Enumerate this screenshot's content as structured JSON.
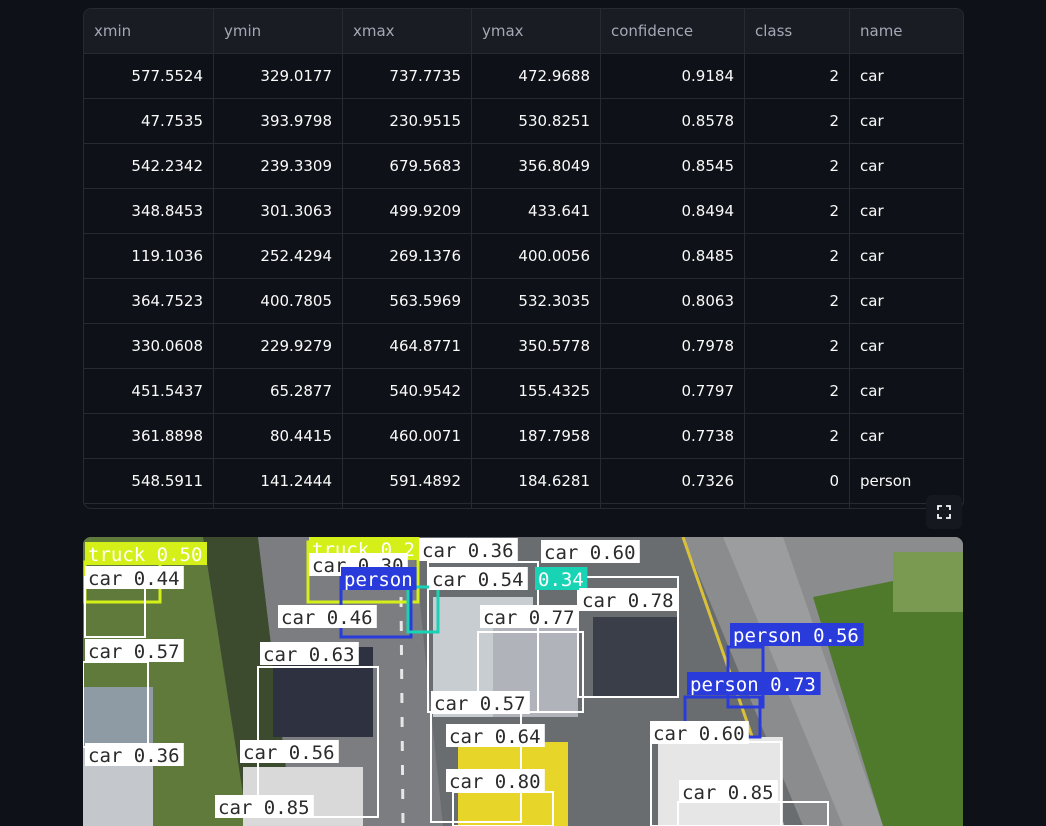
{
  "table": {
    "columns": [
      "xmin",
      "ymin",
      "xmax",
      "ymax",
      "confidence",
      "class",
      "name"
    ],
    "rows": [
      [
        "577.5524",
        "329.0177",
        "737.7735",
        "472.9688",
        "0.9184",
        "2",
        "car"
      ],
      [
        "47.7535",
        "393.9798",
        "230.9515",
        "530.8251",
        "0.8578",
        "2",
        "car"
      ],
      [
        "542.2342",
        "239.3309",
        "679.5683",
        "356.8049",
        "0.8545",
        "2",
        "car"
      ],
      [
        "348.8453",
        "301.3063",
        "499.9209",
        "433.641",
        "0.8494",
        "2",
        "car"
      ],
      [
        "119.1036",
        "252.4294",
        "269.1376",
        "400.0056",
        "0.8485",
        "2",
        "car"
      ],
      [
        "364.7523",
        "400.7805",
        "563.5969",
        "532.3035",
        "0.8063",
        "2",
        "car"
      ],
      [
        "330.0608",
        "229.9279",
        "464.8771",
        "350.5778",
        "0.7978",
        "2",
        "car"
      ],
      [
        "451.5437",
        "65.2877",
        "540.9542",
        "155.4325",
        "0.7797",
        "2",
        "car"
      ],
      [
        "361.8898",
        "80.4415",
        "460.0071",
        "187.7958",
        "0.7738",
        "2",
        "car"
      ],
      [
        "548.5911",
        "141.2444",
        "591.4892",
        "184.6281",
        "0.7326",
        "0",
        "person"
      ]
    ]
  },
  "toolbar": {
    "fullscreen_icon": "fullscreen-icon"
  },
  "detection_image": {
    "labels": [
      {
        "text": "truck 0.50",
        "color": "#d4f018"
      },
      {
        "text": "car 0.44",
        "color": "#ffffff"
      },
      {
        "text": "truck 0.2",
        "color": "#d4f018"
      },
      {
        "text": "car 0.30",
        "color": "#ffffff"
      },
      {
        "text": "person",
        "color": "#2a3bdc"
      },
      {
        "text": "car 0.36",
        "color": "#ffffff"
      },
      {
        "text": "car 0.54",
        "color": "#ffffff"
      },
      {
        "text": "0.34",
        "color": "#18d4b4"
      },
      {
        "text": "car 0.60",
        "color": "#ffffff"
      },
      {
        "text": "car 0.78",
        "color": "#ffffff"
      },
      {
        "text": "car 0.46",
        "color": "#ffffff"
      },
      {
        "text": "car 0.77",
        "color": "#ffffff"
      },
      {
        "text": "person 0.56",
        "color": "#2a3bdc"
      },
      {
        "text": "car 0.57",
        "color": "#ffffff"
      },
      {
        "text": "car 0.63",
        "color": "#ffffff"
      },
      {
        "text": "person 0.73",
        "color": "#2a3bdc"
      },
      {
        "text": "car 0.57",
        "color": "#ffffff"
      },
      {
        "text": "car 0.60",
        "color": "#ffffff"
      },
      {
        "text": "car 0.64",
        "color": "#ffffff"
      },
      {
        "text": "car 0.36",
        "color": "#ffffff"
      },
      {
        "text": "car 0.56",
        "color": "#ffffff"
      },
      {
        "text": "car 0.80",
        "color": "#ffffff"
      },
      {
        "text": "car 0.85",
        "color": "#ffffff"
      },
      {
        "text": "car 0.85",
        "color": "#ffffff"
      }
    ]
  }
}
